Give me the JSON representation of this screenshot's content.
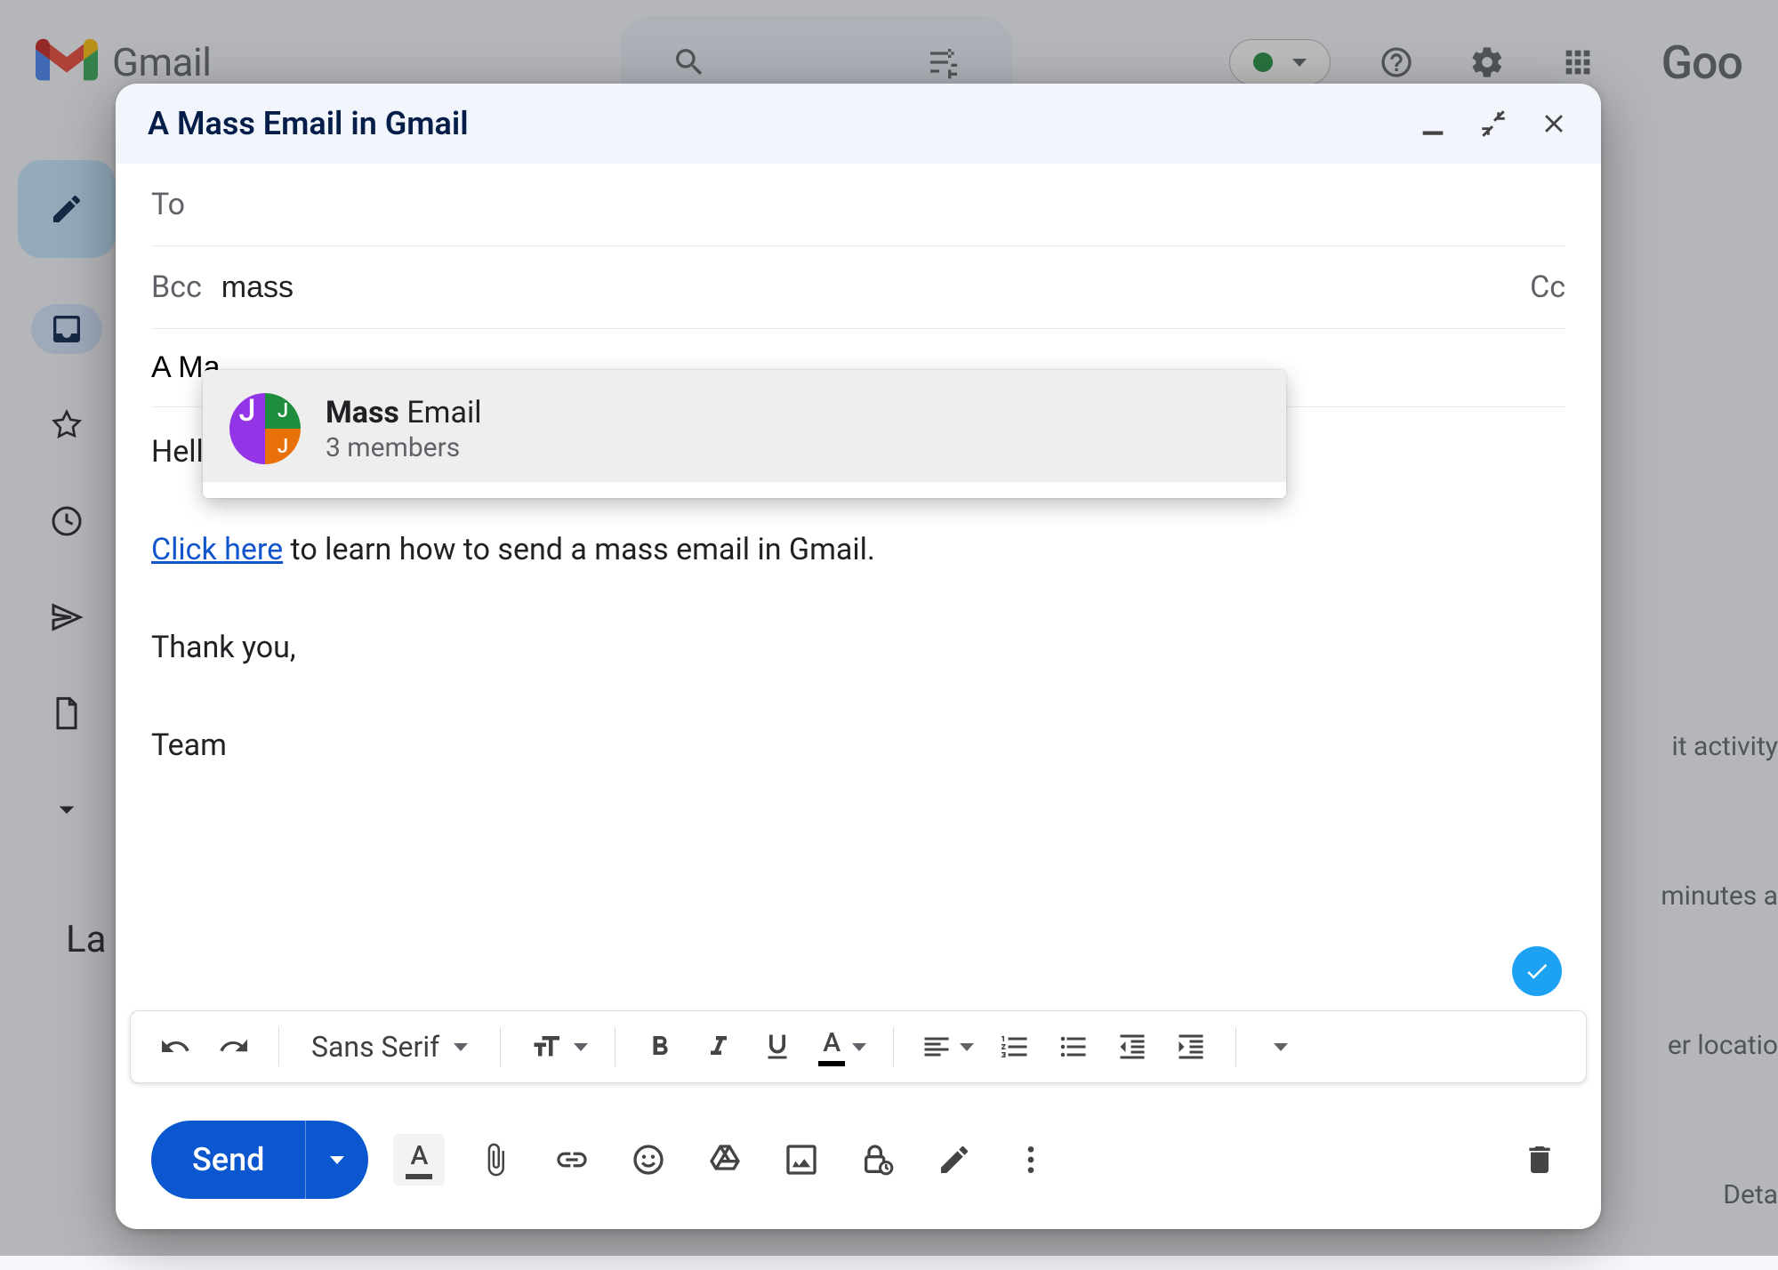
{
  "app": {
    "name": "Gmail"
  },
  "header": {
    "status_color": "#1e8e3e",
    "truncated_account_text": "Goo"
  },
  "background": {
    "left_truncated_label": "La",
    "right_lines": [
      "it activity",
      "minutes a",
      "er locatio",
      "Deta"
    ]
  },
  "compose": {
    "title": "A Mass Email in Gmail",
    "to_label": "To",
    "to_value": "",
    "bcc_label": "Bcc",
    "bcc_value": "mass",
    "cc_label": "Cc",
    "subject_visible_fragment": "A Ma",
    "body": {
      "greeting_fragment": "Hello",
      "link_text": "Click here",
      "link_followup": " to learn how to send a mass email in Gmail.",
      "closing": "Thank you,",
      "signature": "Team"
    },
    "suggestion": {
      "match": "Mass",
      "rest": " Email",
      "subtitle": "3 members",
      "avatar_letters": {
        "tl": "J",
        "tr": "J",
        "bl": "",
        "br": "J"
      }
    },
    "format_toolbar": {
      "font_family": "Sans Serif"
    },
    "actions": {
      "send_label": "Send"
    }
  }
}
